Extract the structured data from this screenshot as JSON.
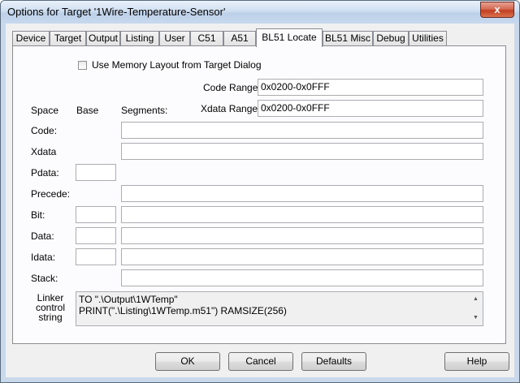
{
  "window": {
    "title": "Options for Target '1Wire-Temperature-Sensor'",
    "close_glyph": "x"
  },
  "tabs": [
    {
      "label": "Device"
    },
    {
      "label": "Target"
    },
    {
      "label": "Output"
    },
    {
      "label": "Listing"
    },
    {
      "label": "User"
    },
    {
      "label": "C51"
    },
    {
      "label": "A51"
    },
    {
      "label": "BL51 Locate",
      "active": true
    },
    {
      "label": "BL51 Misc"
    },
    {
      "label": "Debug"
    },
    {
      "label": "Utilities"
    }
  ],
  "locate": {
    "use_memory_layout_label": "Use Memory Layout from Target Dialog",
    "use_memory_layout_checked": false,
    "code_range_label": "Code Range:",
    "code_range_value": "0x0200-0x0FFF",
    "xdata_range_label": "Xdata Range:",
    "xdata_range_value": "0x0200-0x0FFF",
    "col_space": "Space",
    "col_base": "Base",
    "col_segments": "Segments:",
    "rows": {
      "code": {
        "label": "Code:",
        "segments": ""
      },
      "xdata": {
        "label": "Xdata",
        "segments": ""
      },
      "pdata": {
        "label": "Pdata:",
        "base": ""
      },
      "precede": {
        "label": "Precede:",
        "segments": ""
      },
      "bit": {
        "label": "Bit:",
        "base": "",
        "segments": ""
      },
      "data": {
        "label": "Data:",
        "base": "",
        "segments": ""
      },
      "idata": {
        "label": "Idata:",
        "base": "",
        "segments": ""
      },
      "stack": {
        "label": "Stack:",
        "segments": ""
      }
    },
    "linker_label_1": "Linker",
    "linker_label_2": "control",
    "linker_label_3": "string",
    "linker_line_1": "TO \".\\Output\\1WTemp\"",
    "linker_line_2": "PRINT(\".\\Listing\\1WTemp.m51\") RAMSIZE(256)"
  },
  "buttons": {
    "ok": "OK",
    "cancel": "Cancel",
    "defaults": "Defaults",
    "help": "Help"
  },
  "icons": {
    "close": "close-icon",
    "scroll_up": "scroll-up-arrow-icon",
    "scroll_down": "scroll-down-arrow-icon"
  }
}
